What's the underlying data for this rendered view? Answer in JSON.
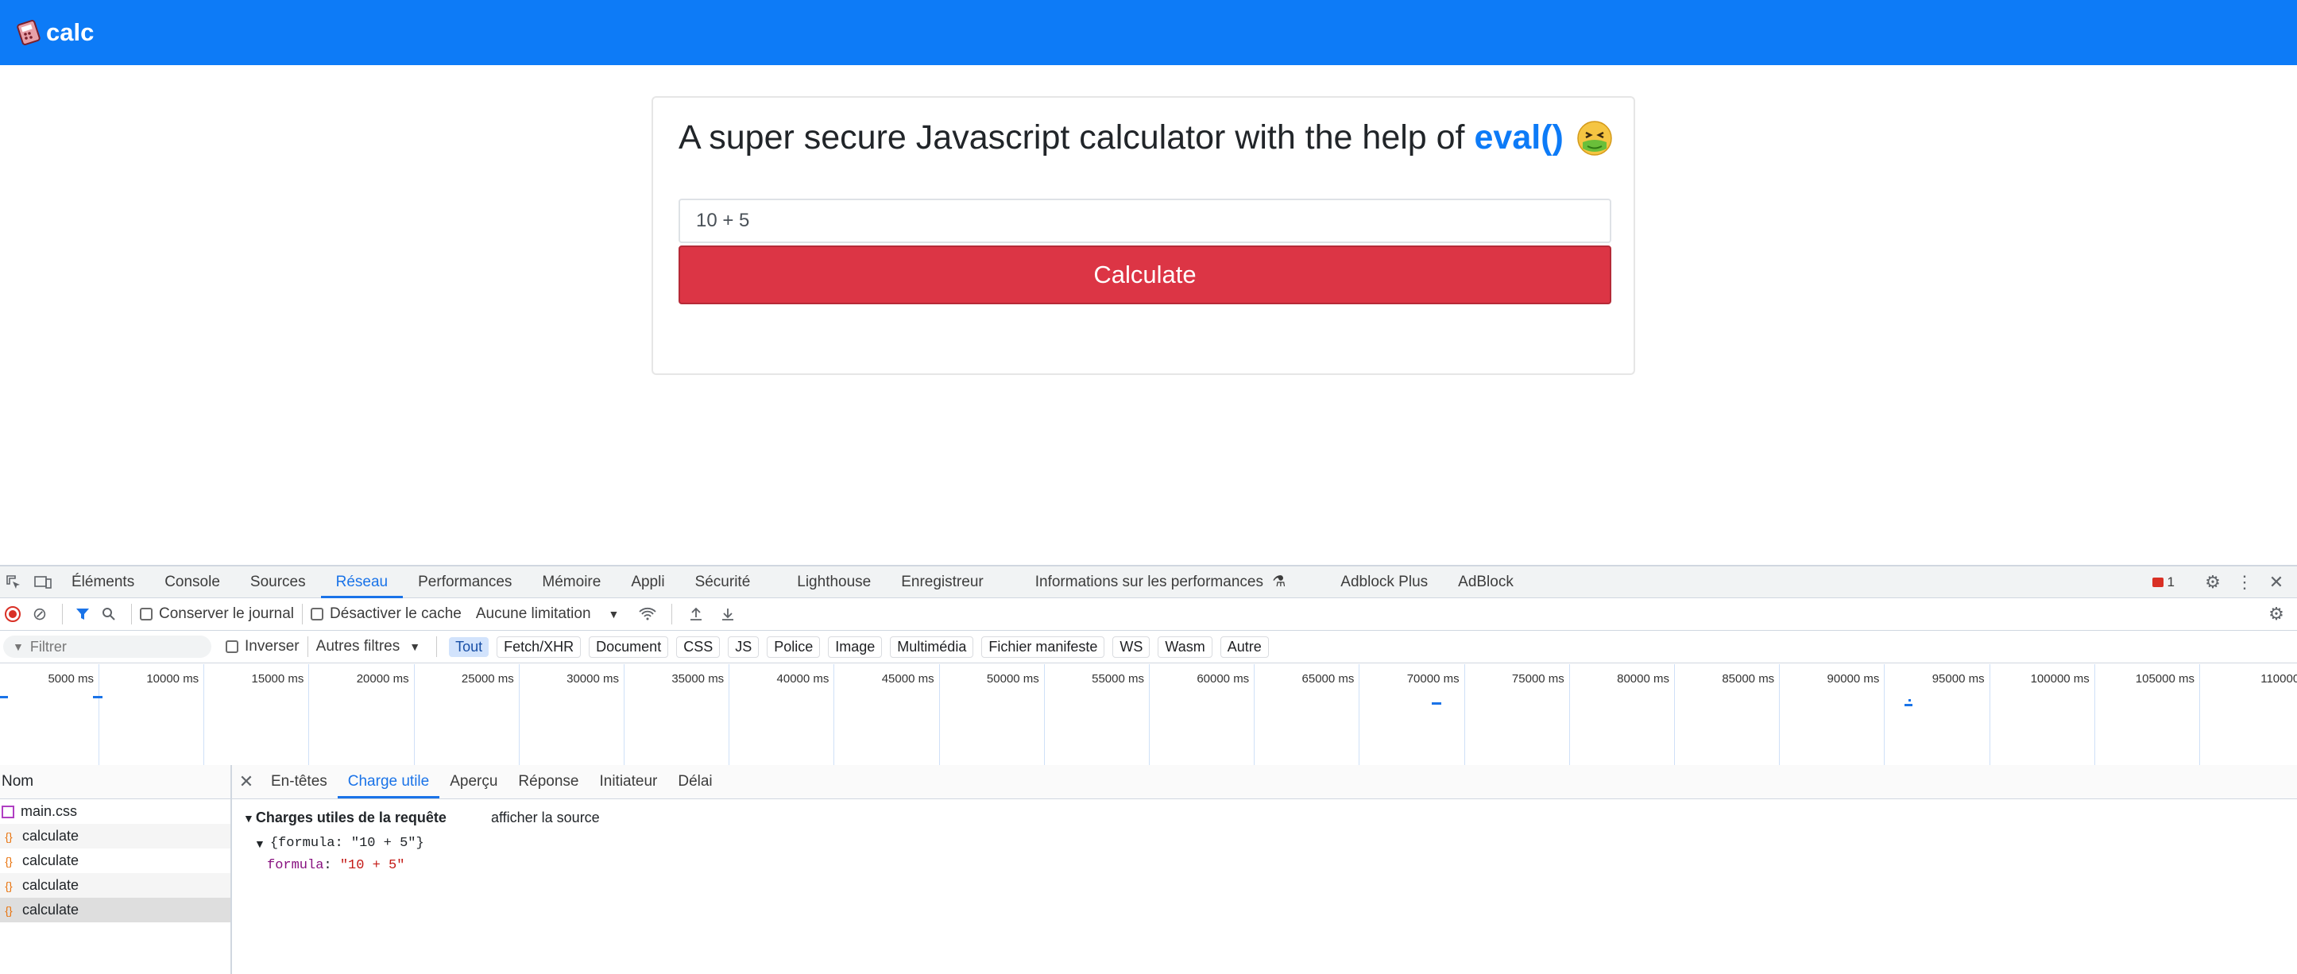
{
  "app": {
    "brand": "calc",
    "heading_prefix": "A super secure Javascript calculator with the help of",
    "heading_highlight": "eval()",
    "input_value": "10 + 5",
    "button_label": "Calculate",
    "colors": {
      "navbar": "#0d7bf7",
      "button": "#dc3545",
      "highlight": "#0d7bf7"
    }
  },
  "devtools": {
    "tabs": [
      "Éléments",
      "Console",
      "Sources",
      "Réseau",
      "Performances",
      "Mémoire",
      "Appli",
      "Sécurité",
      "Lighthouse",
      "Enregistreur",
      "Informations sur les performances",
      "Adblock Plus",
      "AdBlock"
    ],
    "active_tab": "Réseau",
    "issue_count": "1",
    "toolbar": {
      "preserve_log": "Conserver le journal",
      "disable_cache": "Désactiver le cache",
      "throttling": "Aucune limitation"
    },
    "filter": {
      "placeholder": "Filtrer",
      "invert": "Inverser",
      "more_filters": "Autres filtres",
      "types": [
        "Tout",
        "Fetch/XHR",
        "Document",
        "CSS",
        "JS",
        "Police",
        "Image",
        "Multimédia",
        "Fichier manifeste",
        "WS",
        "Wasm",
        "Autre"
      ],
      "active_type": "Tout"
    },
    "timeline_ticks": [
      "5000 ms",
      "10000 ms",
      "15000 ms",
      "20000 ms",
      "25000 ms",
      "30000 ms",
      "35000 ms",
      "40000 ms",
      "45000 ms",
      "50000 ms",
      "55000 ms",
      "60000 ms",
      "65000 ms",
      "70000 ms",
      "75000 ms",
      "80000 ms",
      "85000 ms",
      "90000 ms",
      "95000 ms",
      "100000 ms",
      "105000 ms",
      "110000"
    ],
    "requests": {
      "header": "Nom",
      "items": [
        "main.css",
        "calculate",
        "calculate",
        "calculate",
        "calculate"
      ]
    },
    "detail": {
      "tabs": [
        "En-têtes",
        "Charge utile",
        "Aperçu",
        "Réponse",
        "Initiateur",
        "Délai"
      ],
      "active_tab": "Charge utile",
      "section_title": "Charges utiles de la requête",
      "view_source": "afficher la source",
      "payload_summary": "{formula: \"10 + 5\"}",
      "payload_key": "formula",
      "payload_value": "\"10 + 5\""
    }
  }
}
